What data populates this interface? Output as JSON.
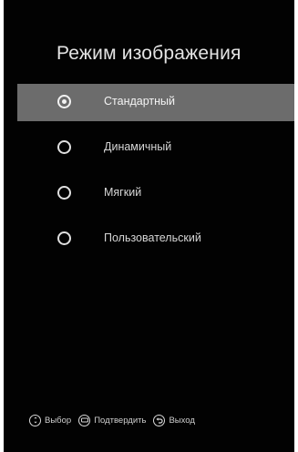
{
  "title": "Режим изображения",
  "menu": {
    "items": [
      {
        "label": "Стандартный",
        "selected": true
      },
      {
        "label": "Динамичный",
        "selected": false
      },
      {
        "label": "Мягкий",
        "selected": false
      },
      {
        "label": "Пользовательский",
        "selected": false
      }
    ]
  },
  "footer": {
    "select": {
      "label": "Выбор",
      "icon": "navigation-pad-icon"
    },
    "confirm": {
      "label": "Подтвердить",
      "icon": "enter-button-icon"
    },
    "exit": {
      "label": "Выход",
      "icon": "return-arrow-icon"
    }
  },
  "colors": {
    "background": "#020202",
    "highlight": "#6c6c6c",
    "text": "#e4e4e4"
  }
}
